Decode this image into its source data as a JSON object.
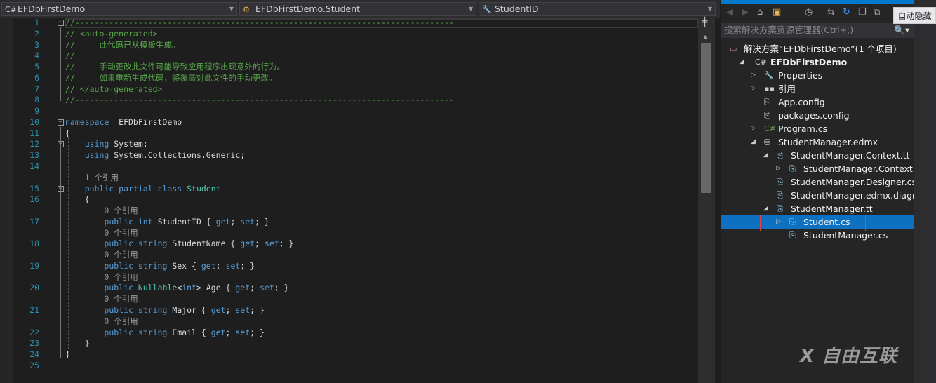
{
  "nav": {
    "project": "EFDbFirstDemo",
    "type": "EFDbFirstDemo.Student",
    "member": "StudentID"
  },
  "code_rows": [
    {
      "n": "1",
      "seg": [
        [
          "cm",
          "//------------------------------------------------------------------------------"
        ]
      ]
    },
    {
      "n": "2",
      "seg": [
        [
          "cm",
          "// <auto-generated>"
        ]
      ]
    },
    {
      "n": "3",
      "seg": [
        [
          "cm",
          "//     此代码已从模板生成。"
        ]
      ]
    },
    {
      "n": "4",
      "seg": [
        [
          "cm",
          "//"
        ]
      ]
    },
    {
      "n": "5",
      "seg": [
        [
          "cm",
          "//     手动更改此文件可能导致应用程序出现意外的行为。"
        ]
      ]
    },
    {
      "n": "6",
      "seg": [
        [
          "cm",
          "//     如果重新生成代码，将覆盖对此文件的手动更改。"
        ]
      ]
    },
    {
      "n": "7",
      "seg": [
        [
          "cm",
          "// </auto-generated>"
        ]
      ]
    },
    {
      "n": "8",
      "seg": [
        [
          "cm",
          "//------------------------------------------------------------------------------"
        ]
      ]
    },
    {
      "n": "9",
      "seg": []
    },
    {
      "n": "10",
      "seg": [
        [
          "kw",
          "namespace"
        ],
        [
          "",
          "  EFDbFirstDemo"
        ]
      ]
    },
    {
      "n": "11",
      "seg": [
        [
          "",
          "{"
        ]
      ]
    },
    {
      "n": "12",
      "seg": [
        [
          "",
          "    "
        ],
        [
          "kw",
          "using"
        ],
        [
          "",
          " System;"
        ]
      ]
    },
    {
      "n": "13",
      "seg": [
        [
          "",
          "    "
        ],
        [
          "kw",
          "using"
        ],
        [
          "",
          " System.Collections.Generic;"
        ]
      ]
    },
    {
      "n": "14",
      "seg": []
    },
    {
      "n": "",
      "seg": [
        [
          "lens",
          "    1 个引用"
        ]
      ]
    },
    {
      "n": "15",
      "seg": [
        [
          "",
          "    "
        ],
        [
          "kw",
          "public partial class"
        ],
        [
          "",
          " "
        ],
        [
          "ty",
          "Student"
        ]
      ]
    },
    {
      "n": "16",
      "seg": [
        [
          "",
          "    {"
        ]
      ]
    },
    {
      "n": "",
      "seg": [
        [
          "lens",
          "        0 个引用"
        ]
      ]
    },
    {
      "n": "17",
      "seg": [
        [
          "",
          "        "
        ],
        [
          "kw",
          "public int"
        ],
        [
          "",
          " StudentID { "
        ],
        [
          "kw",
          "get"
        ],
        [
          "",
          "; "
        ],
        [
          "kw",
          "set"
        ],
        [
          "",
          "; }"
        ]
      ]
    },
    {
      "n": "",
      "seg": [
        [
          "lens",
          "        0 个引用"
        ]
      ]
    },
    {
      "n": "18",
      "seg": [
        [
          "",
          "        "
        ],
        [
          "kw",
          "public string"
        ],
        [
          "",
          " StudentName { "
        ],
        [
          "kw",
          "get"
        ],
        [
          "",
          "; "
        ],
        [
          "kw",
          "set"
        ],
        [
          "",
          "; }"
        ]
      ]
    },
    {
      "n": "",
      "seg": [
        [
          "lens",
          "        0 个引用"
        ]
      ]
    },
    {
      "n": "19",
      "seg": [
        [
          "",
          "        "
        ],
        [
          "kw",
          "public string"
        ],
        [
          "",
          " Sex { "
        ],
        [
          "kw",
          "get"
        ],
        [
          "",
          "; "
        ],
        [
          "kw",
          "set"
        ],
        [
          "",
          "; }"
        ]
      ]
    },
    {
      "n": "",
      "seg": [
        [
          "lens",
          "        0 个引用"
        ]
      ]
    },
    {
      "n": "20",
      "seg": [
        [
          "",
          "        "
        ],
        [
          "kw",
          "public"
        ],
        [
          "",
          " "
        ],
        [
          "ty",
          "Nullable"
        ],
        [
          "",
          "<"
        ],
        [
          "kw",
          "int"
        ],
        [
          "",
          "> Age { "
        ],
        [
          "kw",
          "get"
        ],
        [
          "",
          "; "
        ],
        [
          "kw",
          "set"
        ],
        [
          "",
          "; }"
        ]
      ]
    },
    {
      "n": "",
      "seg": [
        [
          "lens",
          "        0 个引用"
        ]
      ]
    },
    {
      "n": "21",
      "seg": [
        [
          "",
          "        "
        ],
        [
          "kw",
          "public string"
        ],
        [
          "",
          " Major { "
        ],
        [
          "kw",
          "get"
        ],
        [
          "",
          "; "
        ],
        [
          "kw",
          "set"
        ],
        [
          "",
          "; }"
        ]
      ]
    },
    {
      "n": "",
      "seg": [
        [
          "lens",
          "        0 个引用"
        ]
      ]
    },
    {
      "n": "22",
      "seg": [
        [
          "",
          "        "
        ],
        [
          "kw",
          "public string"
        ],
        [
          "",
          " Email { "
        ],
        [
          "kw",
          "get"
        ],
        [
          "",
          "; "
        ],
        [
          "kw",
          "set"
        ],
        [
          "",
          "; }"
        ]
      ]
    },
    {
      "n": "23",
      "seg": [
        [
          "",
          "    }"
        ]
      ]
    },
    {
      "n": "24",
      "seg": [
        [
          "",
          "}"
        ]
      ]
    },
    {
      "n": "25",
      "seg": []
    }
  ],
  "solution_explorer": {
    "search_placeholder": "搜索解决方案资源管理器(Ctrl+;)",
    "tooltip": "自动隐藏",
    "items": [
      {
        "label": "解决方案“EFDbFirstDemo”(1 个项目)",
        "level": 0,
        "expander": "",
        "icon": "solution-icon"
      },
      {
        "label": "EFDbFirstDemo",
        "level": 1,
        "expander": "expanded",
        "icon": "csharp-project-icon",
        "bold": true
      },
      {
        "label": "Properties",
        "level": 2,
        "expander": "collapsed",
        "icon": "wrench-icon"
      },
      {
        "label": "引用",
        "level": 2,
        "expander": "collapsed",
        "icon": "references-icon"
      },
      {
        "label": "App.config",
        "level": 2,
        "expander": "",
        "icon": "config-icon"
      },
      {
        "label": "packages.config",
        "level": 2,
        "expander": "",
        "icon": "config-icon"
      },
      {
        "label": "Program.cs",
        "level": 2,
        "expander": "collapsed",
        "icon": "csharp-file-icon"
      },
      {
        "label": "StudentManager.edmx",
        "level": 2,
        "expander": "expanded",
        "icon": "edmx-icon"
      },
      {
        "label": "StudentManager.Context.tt",
        "level": 3,
        "expander": "expanded",
        "icon": "file-icon"
      },
      {
        "label": "StudentManager.Context.cs",
        "level": 4,
        "expander": "collapsed",
        "icon": "file-icon"
      },
      {
        "label": "StudentManager.Designer.cs",
        "level": 3,
        "expander": "",
        "icon": "file-icon"
      },
      {
        "label": "StudentManager.edmx.diagram",
        "level": 3,
        "expander": "",
        "icon": "file-icon"
      },
      {
        "label": "StudentManager.tt",
        "level": 3,
        "expander": "expanded",
        "icon": "file-icon"
      },
      {
        "label": "Student.cs",
        "level": 4,
        "expander": "collapsed",
        "icon": "file-icon",
        "selected": true
      },
      {
        "label": "StudentManager.cs",
        "level": 4,
        "expander": "",
        "icon": "file-icon"
      }
    ]
  },
  "watermark": "自由互联",
  "colors": {
    "accent": "#007acc",
    "selection": "#0e70c0",
    "keyword": "#569cd6",
    "type": "#4ec9b0",
    "comment": "#57a64a"
  }
}
